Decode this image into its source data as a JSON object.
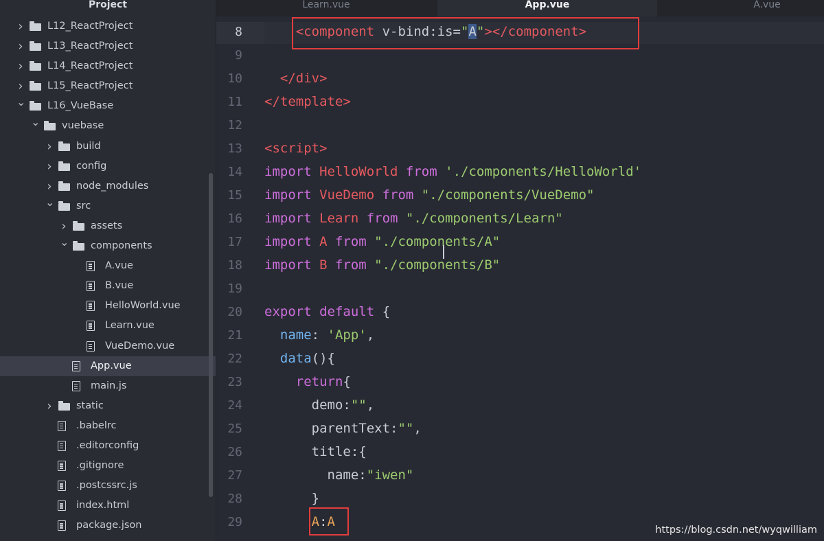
{
  "sidebar": {
    "title": "Project",
    "items": [
      {
        "label": "L12_ReactProject",
        "type": "folder",
        "depth": 1,
        "expanded": false
      },
      {
        "label": "L13_ReactProject",
        "type": "folder",
        "depth": 1,
        "expanded": false
      },
      {
        "label": "L14_ReactProject",
        "type": "folder",
        "depth": 1,
        "expanded": false
      },
      {
        "label": "L15_ReactProject",
        "type": "folder",
        "depth": 1,
        "expanded": false
      },
      {
        "label": "L16_VueBase",
        "type": "folder",
        "depth": 1,
        "expanded": true
      },
      {
        "label": "vuebase",
        "type": "folder",
        "depth": 2,
        "expanded": true
      },
      {
        "label": "build",
        "type": "folder",
        "depth": 3,
        "expanded": false
      },
      {
        "label": "config",
        "type": "folder",
        "depth": 3,
        "expanded": false
      },
      {
        "label": "node_modules",
        "type": "folder",
        "depth": 3,
        "expanded": false
      },
      {
        "label": "src",
        "type": "folder",
        "depth": 3,
        "expanded": true
      },
      {
        "label": "assets",
        "type": "folder",
        "depth": 4,
        "expanded": false
      },
      {
        "label": "components",
        "type": "folder",
        "depth": 4,
        "expanded": true
      },
      {
        "label": "A.vue",
        "type": "file",
        "depth": 5
      },
      {
        "label": "B.vue",
        "type": "file",
        "depth": 5
      },
      {
        "label": "HelloWorld.vue",
        "type": "file",
        "depth": 5
      },
      {
        "label": "Learn.vue",
        "type": "file",
        "depth": 5
      },
      {
        "label": "VueDemo.vue",
        "type": "file",
        "depth": 5
      },
      {
        "label": "App.vue",
        "type": "file",
        "depth": 4,
        "selected": true
      },
      {
        "label": "main.js",
        "type": "file",
        "depth": 4
      },
      {
        "label": "static",
        "type": "folder",
        "depth": 3,
        "expanded": false
      },
      {
        "label": ".babelrc",
        "type": "file",
        "depth": 3
      },
      {
        "label": ".editorconfig",
        "type": "file",
        "depth": 3
      },
      {
        "label": ".gitignore",
        "type": "file",
        "depth": 3
      },
      {
        "label": ".postcssrc.js",
        "type": "file",
        "depth": 3
      },
      {
        "label": "index.html",
        "type": "file",
        "depth": 3
      },
      {
        "label": "package.json",
        "type": "file",
        "depth": 3
      }
    ]
  },
  "tabs": [
    {
      "label": "Learn.vue",
      "active": false
    },
    {
      "label": "App.vue",
      "active": true
    },
    {
      "label": "A.vue",
      "active": false
    }
  ],
  "editor": {
    "current_line": "8",
    "lines": [
      {
        "n": "8",
        "tokens": [
          [
            "p",
            "    "
          ],
          [
            "tag",
            "<component"
          ],
          [
            "p",
            " v-bind:is="
          ],
          [
            "str",
            "\""
          ],
          [
            "sel",
            "A"
          ],
          [
            "str",
            "\""
          ],
          [
            "tag",
            ">"
          ],
          [
            "tag",
            "</component>"
          ]
        ]
      },
      {
        "n": "9",
        "tokens": []
      },
      {
        "n": "10",
        "tokens": [
          [
            "p",
            "  "
          ],
          [
            "tag",
            "</div>"
          ]
        ]
      },
      {
        "n": "11",
        "tokens": [
          [
            "tag",
            "</template>"
          ]
        ]
      },
      {
        "n": "12",
        "tokens": []
      },
      {
        "n": "13",
        "tokens": [
          [
            "tag",
            "<script>"
          ]
        ]
      },
      {
        "n": "14",
        "tokens": [
          [
            "kw",
            "import "
          ],
          [
            "id",
            "HelloWorld "
          ],
          [
            "kw",
            "from "
          ],
          [
            "str",
            "'./components/HelloWorld'"
          ]
        ]
      },
      {
        "n": "15",
        "tokens": [
          [
            "kw",
            "import "
          ],
          [
            "id",
            "VueDemo "
          ],
          [
            "kw",
            "from "
          ],
          [
            "str",
            "\"./components/VueDemo\""
          ]
        ]
      },
      {
        "n": "16",
        "tokens": [
          [
            "kw",
            "import "
          ],
          [
            "id",
            "Learn "
          ],
          [
            "kw",
            "from "
          ],
          [
            "str",
            "\"./components/Learn\""
          ]
        ]
      },
      {
        "n": "17",
        "tokens": [
          [
            "kw",
            "import "
          ],
          [
            "id",
            "A "
          ],
          [
            "kw",
            "from "
          ],
          [
            "str",
            "\"./components/A\""
          ]
        ]
      },
      {
        "n": "18",
        "tokens": [
          [
            "kw",
            "import "
          ],
          [
            "id",
            "B "
          ],
          [
            "kw",
            "from "
          ],
          [
            "str",
            "\"./components/B\""
          ]
        ]
      },
      {
        "n": "19",
        "tokens": []
      },
      {
        "n": "20",
        "tokens": [
          [
            "kw",
            "export default "
          ],
          [
            "p",
            "{"
          ]
        ]
      },
      {
        "n": "21",
        "tokens": [
          [
            "p",
            "  "
          ],
          [
            "prop",
            "name"
          ],
          [
            "p",
            ": "
          ],
          [
            "str",
            "'App'"
          ],
          [
            "p",
            ","
          ]
        ]
      },
      {
        "n": "22",
        "tokens": [
          [
            "p",
            "  "
          ],
          [
            "prop",
            "data"
          ],
          [
            "p",
            "(){"
          ]
        ]
      },
      {
        "n": "23",
        "tokens": [
          [
            "p",
            "    "
          ],
          [
            "kw",
            "return"
          ],
          [
            "p",
            "{"
          ]
        ]
      },
      {
        "n": "24",
        "tokens": [
          [
            "p",
            "      demo:"
          ],
          [
            "str",
            "\"\""
          ],
          [
            "p",
            ","
          ]
        ]
      },
      {
        "n": "25",
        "tokens": [
          [
            "p",
            "      parentText:"
          ],
          [
            "str",
            "\"\""
          ],
          [
            "p",
            ","
          ]
        ]
      },
      {
        "n": "26",
        "tokens": [
          [
            "p",
            "      title:{"
          ]
        ]
      },
      {
        "n": "27",
        "tokens": [
          [
            "p",
            "        name:"
          ],
          [
            "str",
            "\"iwen\""
          ]
        ]
      },
      {
        "n": "28",
        "tokens": [
          [
            "p",
            "      }"
          ]
        ]
      },
      {
        "n": "29",
        "tokens": [
          [
            "p",
            "      "
          ],
          [
            "orange",
            "A"
          ],
          [
            "p",
            ":"
          ],
          [
            "orange",
            "A"
          ]
        ]
      }
    ]
  },
  "watermark": "https://blog.csdn.net/wyqwilliam",
  "colors": {
    "highlight_box": "#e23d3d",
    "background": "#282a33",
    "keyword": "#cc6edb",
    "string": "#9ccb6f"
  }
}
